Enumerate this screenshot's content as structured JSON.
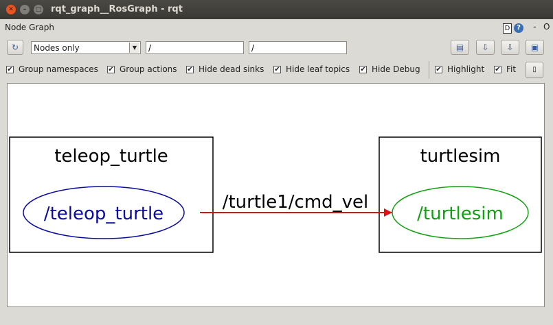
{
  "window": {
    "title": "rqt_graph__RosGraph - rqt"
  },
  "dock": {
    "title": "Node Graph",
    "d_label": "D",
    "help_label": "?",
    "minimize_label": "-",
    "close_label": "O"
  },
  "toolbar": {
    "filter_mode": "Nodes only",
    "ns_filter": "/",
    "topic_filter": "/"
  },
  "options": {
    "group_namespaces": "Group namespaces",
    "group_actions": "Group actions",
    "hide_dead_sinks": "Hide dead sinks",
    "hide_leaf_topics": "Hide leaf topics",
    "hide_debug": "Hide Debug",
    "highlight": "Highlight",
    "fit": "Fit",
    "check_mark": "✔"
  },
  "graph": {
    "clusters": [
      {
        "label": "teleop_turtle",
        "node": "/teleop_turtle",
        "node_color": "#0b0b9e"
      },
      {
        "label": "turtlesim",
        "node": "/turtlesim",
        "node_color": "#12a012"
      }
    ],
    "edge": {
      "label": "/turtle1/cmd_vel",
      "color": "#dd1111"
    }
  }
}
